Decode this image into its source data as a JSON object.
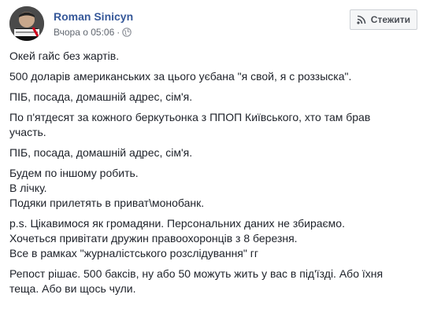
{
  "post": {
    "author": "Roman Sinicyn",
    "timestamp": "Вчора о 05:06",
    "separator": "·",
    "privacy_icon": "globe-icon",
    "follow_label": "Стежити",
    "follow_icon": "rss-icon",
    "avatar_text": "ТО ЗАМОВИ\nЧИЇ ВИБОРИ"
  },
  "content": {
    "p1": "Окей гайс без жартів.",
    "p2": "500 доларів американських за цього уєбана \"я свой, я с роззыска\".",
    "p3": "ПІБ, посада, домашній адрес, сім'я.",
    "p4_l1": "По п'ятдесят за кожного беркутьонка з ППОП Київського, хто там брав",
    "p4_l2": "участь.",
    "p5": "ПІБ, посада, домашній адрес, сім'я.",
    "p6_l1": "Будем по іншому робить.",
    "p6_l2": "В лічку.",
    "p6_l3": "Подяки прилетять в приват\\монобанк.",
    "p7_l1": "p.s. Цікавимося як громадяни. Персональних даних не збираємо.",
    "p7_l2": "Хочеться привітати дружин правоохоронців з 8 березня.",
    "p7_l3": "Все в рамках \"журналістського розслідування\" гг",
    "p8_l1": "Репост рішає. 500 баксів, ну або 50 можуть жить у вас в під'їзді. Або їхня",
    "p8_l2": "теща. Або ви щось чули."
  },
  "colors": {
    "author": "#365899",
    "meta": "#616770",
    "text": "#1d2129",
    "button_bg": "#f5f6f7",
    "button_border": "#ccd0d5"
  }
}
